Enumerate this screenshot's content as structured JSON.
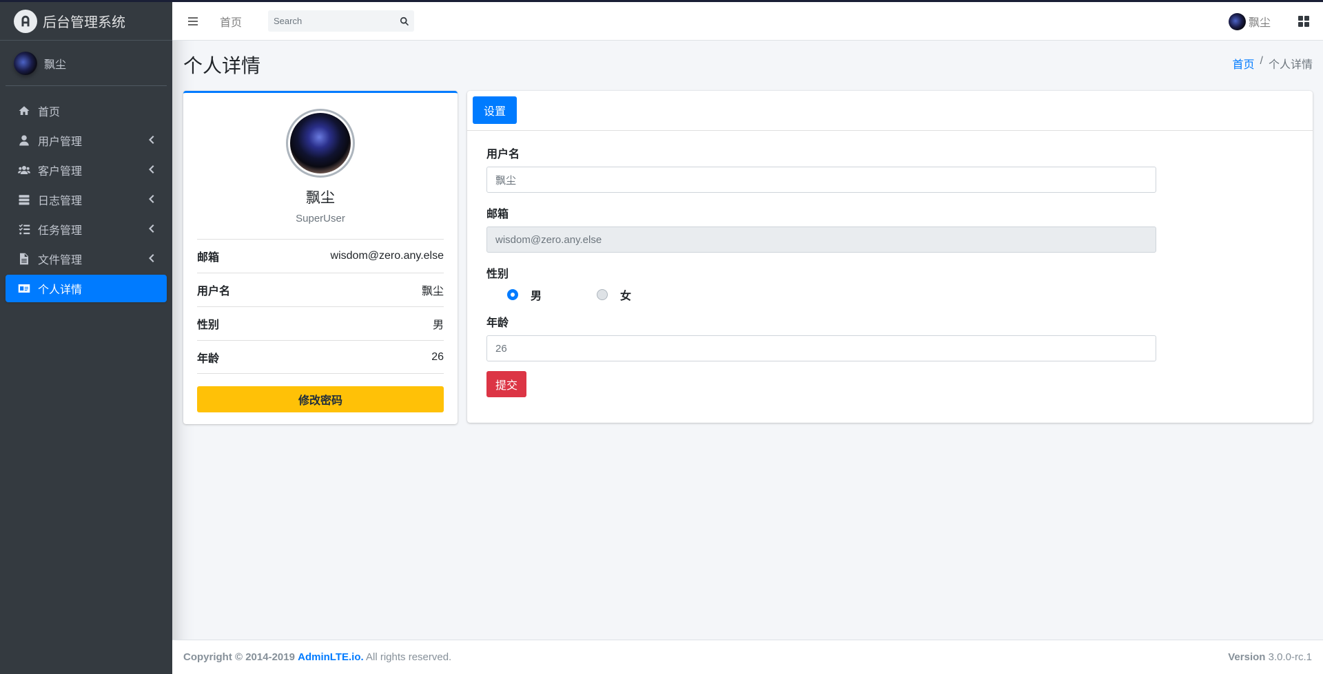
{
  "brand": {
    "title": "后台管理系统",
    "logo_icon": "adminlte-logo-icon"
  },
  "sidebar": {
    "user_name": "飘尘",
    "items": [
      {
        "label": "首页",
        "icon": "home-icon",
        "has_arrow": false,
        "active": false
      },
      {
        "label": "用户管理",
        "icon": "user-icon",
        "has_arrow": true,
        "active": false
      },
      {
        "label": "客户管理",
        "icon": "users-icon",
        "has_arrow": true,
        "active": false
      },
      {
        "label": "日志管理",
        "icon": "database-icon",
        "has_arrow": true,
        "active": false
      },
      {
        "label": "任务管理",
        "icon": "tasks-icon",
        "has_arrow": true,
        "active": false
      },
      {
        "label": "文件管理",
        "icon": "file-icon",
        "has_arrow": true,
        "active": false
      },
      {
        "label": "个人详情",
        "icon": "id-card-icon",
        "has_arrow": false,
        "active": true
      }
    ]
  },
  "navbar": {
    "home_label": "首页",
    "search_placeholder": "Search",
    "user_name": "飘尘"
  },
  "page": {
    "title": "个人详情",
    "breadcrumb": {
      "home": "首页",
      "separator": "/",
      "current": "个人详情"
    }
  },
  "profile": {
    "name": "飘尘",
    "role": "SuperUser",
    "rows": [
      {
        "key": "邮箱",
        "value": "wisdom@zero.any.else"
      },
      {
        "key": "用户名",
        "value": "飘尘"
      },
      {
        "key": "性别",
        "value": "男"
      },
      {
        "key": "年龄",
        "value": "26"
      }
    ],
    "change_password_label": "修改密码"
  },
  "settings": {
    "tab_label": "设置",
    "username_label": "用户名",
    "username_value": "飘尘",
    "email_label": "邮箱",
    "email_value": "wisdom@zero.any.else",
    "gender_label": "性别",
    "gender_options": [
      "男",
      "女"
    ],
    "gender_selected": "男",
    "age_label": "年龄",
    "age_value": "26",
    "submit_label": "提交"
  },
  "footer": {
    "copyright_prefix": "Copyright © 2014-2019",
    "copyright_link": "AdminLTE.io.",
    "copyright_suffix": "All rights reserved.",
    "version_label": "Version",
    "version_value": "3.0.0-rc.1"
  },
  "colors": {
    "sidebar_bg": "#343a40",
    "primary": "#007bff",
    "warning": "#ffc107",
    "danger": "#dc3545",
    "content_bg": "#f4f6f9"
  }
}
